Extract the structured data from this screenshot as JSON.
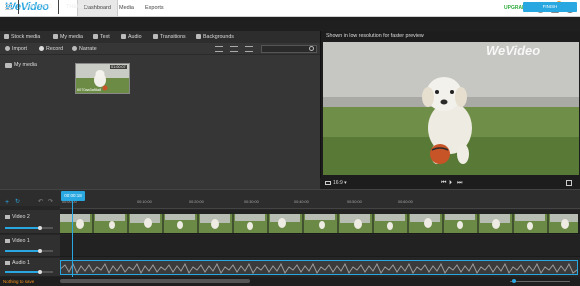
{
  "app": {
    "logo": "WeVideo"
  },
  "topnav": {
    "tabs": [
      "Dashboard",
      "Media",
      "Exports"
    ],
    "active": "Dashboard",
    "upgrade": "UPGRADE",
    "notifications": "2",
    "avatar_initial": "M"
  },
  "projbar": {
    "tabs": [
      "MY VIDEO",
      "THEMES"
    ],
    "finish": "FINISH"
  },
  "media": {
    "tabs": [
      "Stock media",
      "My media",
      "Text",
      "Audio",
      "Transitions",
      "Backgrounds"
    ],
    "actions": [
      "Import",
      "Record",
      "Narrate"
    ],
    "folder": "My media",
    "thumb": {
      "duration": "01:00:07",
      "name": "6070aa3af8a8"
    }
  },
  "preview": {
    "message": "Shown in low resolution for faster preview",
    "watermark": "WeVideo",
    "aspect": "16:9 ▾"
  },
  "timeline": {
    "playhead": "00:00:18",
    "ticks": [
      "00:00:00",
      "00:10:00",
      "00:20:00",
      "00:30:00",
      "00:40:00",
      "00:50:00",
      "00:60:00"
    ],
    "tracks": [
      "Video 2",
      "Video 1",
      "Audio 1"
    ]
  },
  "status": {
    "text": "Nothing to save"
  },
  "colors": {
    "accent": "#29a7e1",
    "upgrade": "#2eaa3c",
    "grass": "#6f8f48"
  }
}
